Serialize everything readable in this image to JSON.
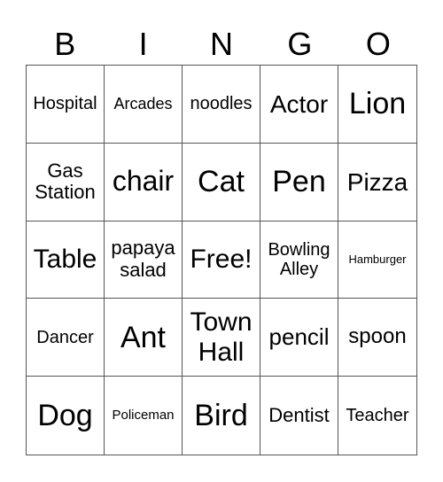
{
  "header": [
    "B",
    "I",
    "N",
    "G",
    "O"
  ],
  "cells": [
    "Hospital",
    "Arcades",
    "noodles",
    "Actor",
    "Lion",
    "Gas Station",
    "chair",
    "Cat",
    "Pen",
    "Pizza",
    "Table",
    "papaya salad",
    "Free!",
    "Bowling Alley",
    "Hamburger",
    "Dancer",
    "Ant",
    "Town Hall",
    "pencil",
    "spoon",
    "Dog",
    "Policeman",
    "Bird",
    "Dentist",
    "Teacher"
  ]
}
